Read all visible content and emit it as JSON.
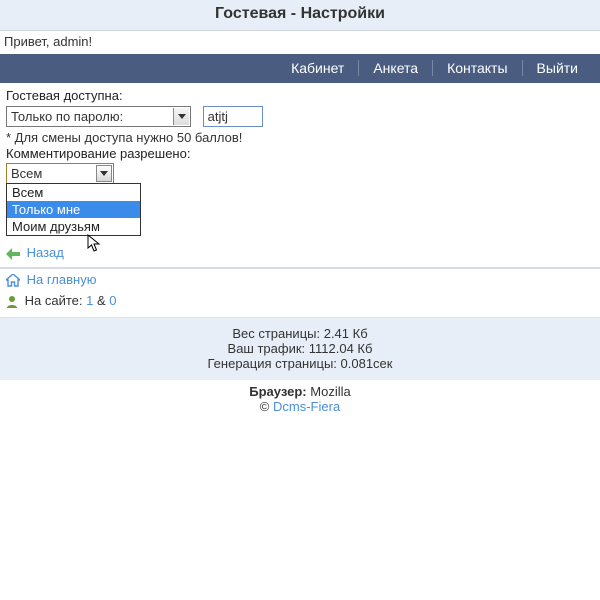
{
  "title": "Гостевая - Настройки",
  "greeting": "Привет, admin!",
  "nav": {
    "cabinet": "Кабинет",
    "anketa": "Анкета",
    "contacts": "Контакты",
    "logout": "Выйти"
  },
  "form": {
    "access_label": "Гостевая доступна:",
    "access_value": "Только по паролю:",
    "password_value": "atjtj",
    "note": "* Для смены доступа нужно 50 баллов!",
    "comment_label": "Комментирование разрешено:",
    "comment_selected": "Всем",
    "comment_options": {
      "o0": "Всем",
      "o1": "Только мне",
      "o2": "Моим друзьям"
    }
  },
  "links": {
    "back": "Назад",
    "home": "На главную",
    "online_prefix": "На сайте: ",
    "online_n1": "1",
    "online_amp": " & ",
    "online_n2": "0"
  },
  "stats": {
    "weight": "Вес страницы: 2.41 Кб",
    "traffic": "Ваш трафик: 1112.04 Кб",
    "gen": "Генерация страницы: 0.081сек"
  },
  "footer": {
    "browser_label": "Браузер:",
    "browser_value": "Mozilla",
    "copy": "©",
    "site": "Dcms-Fiera"
  }
}
